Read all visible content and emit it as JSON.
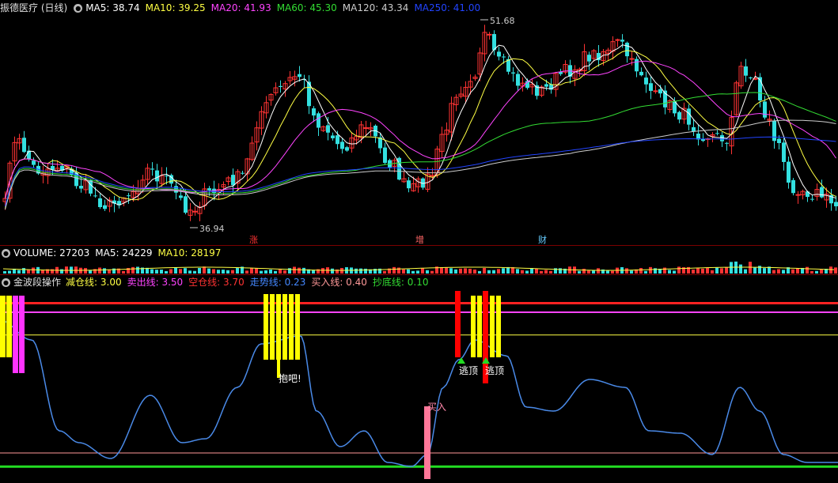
{
  "price_panel": {
    "title": "振德医疗 (日线)",
    "indicators": [
      {
        "label": "MA5: 38.74",
        "color": "#ffffff"
      },
      {
        "label": "MA10: 39.25",
        "color": "#ffff44"
      },
      {
        "label": "MA20: 41.93",
        "color": "#ff44ff"
      },
      {
        "label": "MA60: 45.30",
        "color": "#33dd33"
      },
      {
        "label": "MA120: 43.34",
        "color": "#cccccc"
      },
      {
        "label": "MA250: 41.00",
        "color": "#2244ff"
      }
    ],
    "high_label": "51.68",
    "low_label": "36.94",
    "event_tags": [
      {
        "text": "涨",
        "color": "#ff3333"
      },
      {
        "text": "增",
        "color": "#ff6666"
      },
      {
        "text": "财",
        "color": "#66ccff"
      }
    ],
    "colors": {
      "up": "#ff3333",
      "down": "#33e0e0"
    }
  },
  "volume_panel": {
    "indicators": [
      {
        "label": "VOLUME: 27203",
        "color": "#ffffff"
      },
      {
        "label": "MA5: 24229",
        "color": "#ffffff"
      },
      {
        "label": "MA10: 28197",
        "color": "#ffff44"
      }
    ]
  },
  "wave_panel": {
    "title": "金波段操作",
    "indicators": [
      {
        "label": "减仓线: 3.00",
        "color": "#ffff44"
      },
      {
        "label": "卖出线: 3.50",
        "color": "#ff44ff"
      },
      {
        "label": "空仓线: 3.70",
        "color": "#ff3333"
      },
      {
        "label": "走势线: 0.23",
        "color": "#4488ff"
      },
      {
        "label": "买入线: 0.40",
        "color": "#ff9999"
      },
      {
        "label": "抄底线: 0.10",
        "color": "#33dd33"
      }
    ],
    "annotations": [
      "抱吧!",
      "买入",
      "逃顶",
      "逃顶"
    ]
  }
}
